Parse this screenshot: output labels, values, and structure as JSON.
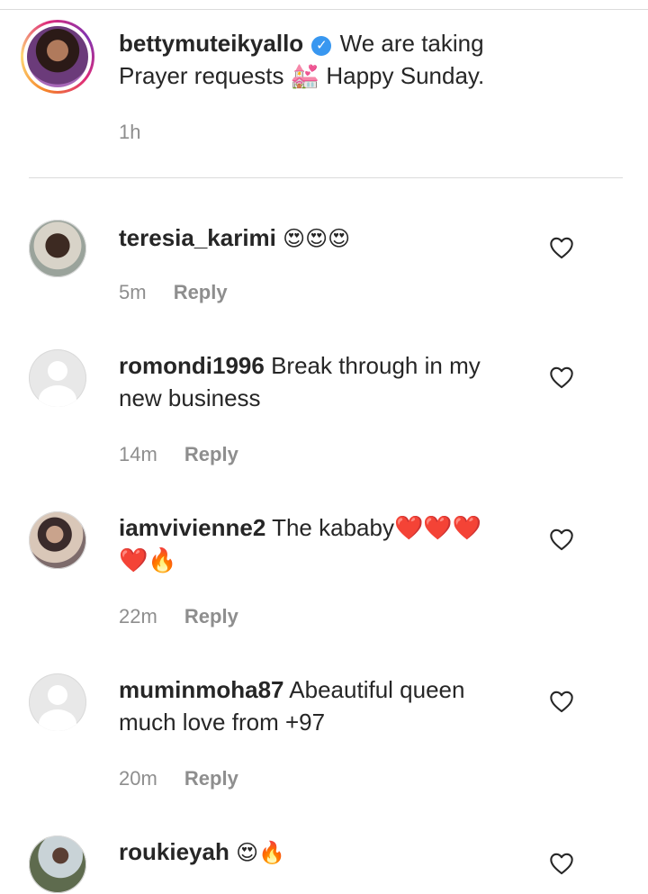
{
  "caption": {
    "username": "bettymuteikyallo",
    "text": "We are taking Prayer requests 💒 Happy Sunday.",
    "time": "1h"
  },
  "comments": [
    {
      "username": "teresia_karimi",
      "text": "😍😍😍",
      "time": "5m",
      "reply": "Reply"
    },
    {
      "username": "romondi1996",
      "text": "Break through in my new business",
      "time": "14m",
      "reply": "Reply"
    },
    {
      "username": "iamvivienne2",
      "text": "The kababy❤️❤️❤️ ❤️🔥",
      "time": "22m",
      "reply": "Reply"
    },
    {
      "username": "muminmoha87",
      "text": "Abeautiful queen much love from +97",
      "time": "20m",
      "reply": "Reply"
    },
    {
      "username": "roukieyah",
      "text": "😍🔥",
      "time": "",
      "reply": ""
    }
  ],
  "icons": {
    "verified": "verified-badge-icon",
    "like": "heart-outline-icon",
    "accent": "#3897f0"
  }
}
